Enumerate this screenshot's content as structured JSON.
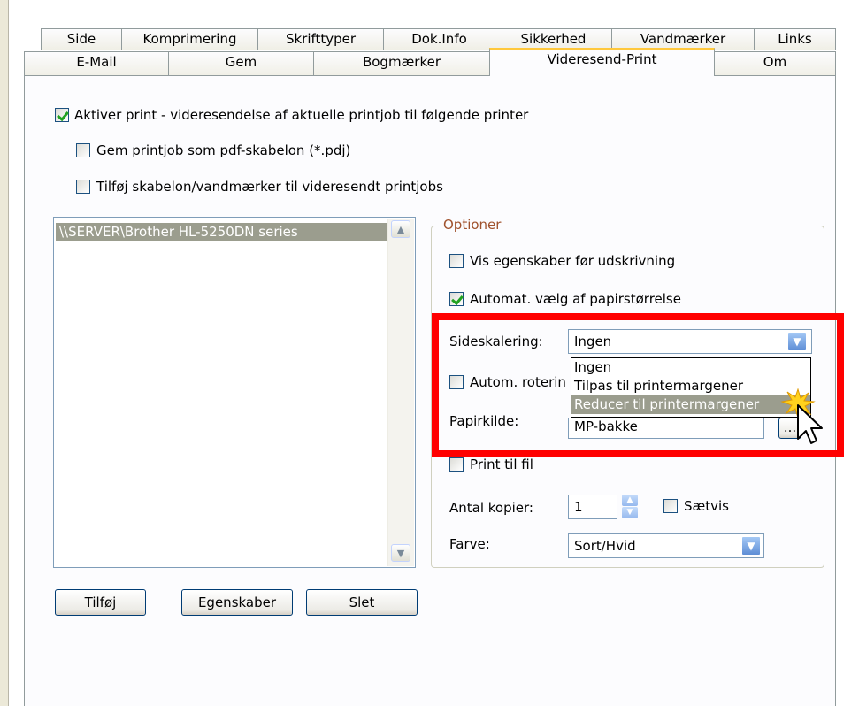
{
  "tabs_row1": [
    {
      "label": "Side"
    },
    {
      "label": "Komprimering"
    },
    {
      "label": "Skrifttyper"
    },
    {
      "label": "Dok.Info"
    },
    {
      "label": "Sikkerhed"
    },
    {
      "label": "Vandmærker"
    },
    {
      "label": "Links"
    }
  ],
  "tabs_row2": [
    {
      "label": "E-Mail"
    },
    {
      "label": "Gem"
    },
    {
      "label": "Bogmærker"
    },
    {
      "label": "Videresend-Print",
      "active": true
    },
    {
      "label": "Om"
    }
  ],
  "options_top": {
    "enable_forward": {
      "label": "Aktiver print - videresendelse af aktuelle printjob til følgende printer",
      "checked": true
    },
    "save_template": {
      "label": "Gem printjob som pdf-skabelon (*.pdj)",
      "checked": false
    },
    "add_template": {
      "label": "Tilføj skabelon/vandmærker til videresendt printjobs",
      "checked": false
    }
  },
  "printer_list": {
    "items": [
      "\\\\SERVER\\Brother HL-5250DN series"
    ]
  },
  "buttons": {
    "add": "Tilføj",
    "properties": "Egenskaber",
    "delete": "Slet"
  },
  "group": {
    "title": "Optioner",
    "show_properties": {
      "label": "Vis egenskaber før udskrivning",
      "checked": false
    },
    "auto_paper": {
      "label": "Automat. vælg af papirstørrelse",
      "checked": true
    },
    "scaling_label": "Sideskalering:",
    "scaling_value": "Ingen",
    "scaling_options": [
      "Ingen",
      "Tilpas til printermargener",
      "Reducer til printermargener"
    ],
    "scaling_highlighted": "Reducer til printermargener",
    "auto_rotate": {
      "label": "Autom. roterin",
      "checked": false
    },
    "paper_source_label": "Papirkilde:",
    "paper_source_value": "MP-bakke",
    "paper_source_button": "...",
    "print_to_file": {
      "label": "Print til fil",
      "checked": false
    },
    "copies_label": "Antal kopier:",
    "copies_value": "1",
    "collate": {
      "label": "Sætvis",
      "checked": false
    },
    "color_label": "Farve:",
    "color_value": "Sort/Hvid"
  },
  "colors": {
    "highlight_frame": "#ff0000",
    "selection": "#9b9d8e",
    "active_tab_accent": "#ffc83c"
  }
}
